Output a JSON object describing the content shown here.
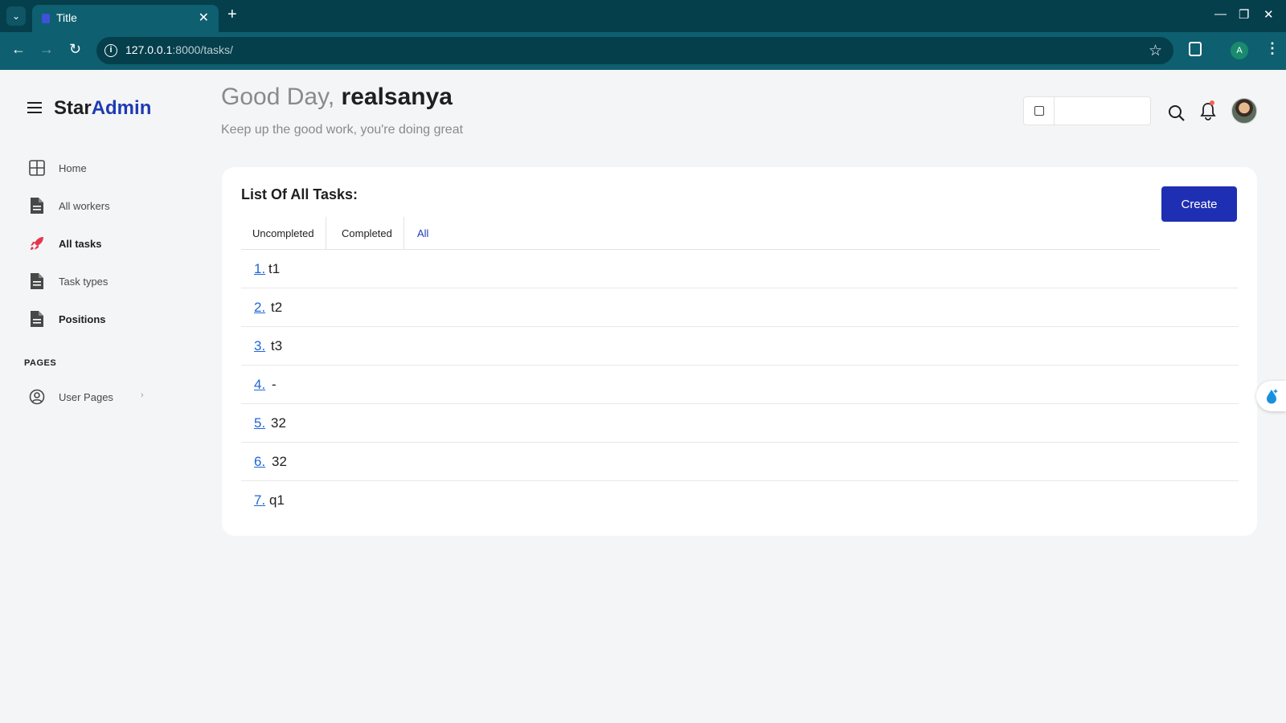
{
  "browser": {
    "tab_title": "Title",
    "url_host": "127.0.0.1",
    "url_path": ":8000/tasks/",
    "profile_initial": "A"
  },
  "sidebar": {
    "brand_main": "Star",
    "brand_accent": "Admin",
    "items": [
      {
        "label": "Home",
        "icon": "grid-icon"
      },
      {
        "label": "All workers",
        "icon": "document-icon"
      },
      {
        "label": "All tasks",
        "icon": "rocket-icon"
      },
      {
        "label": "Task types",
        "icon": "document-icon"
      },
      {
        "label": "Positions",
        "icon": "document-icon"
      }
    ],
    "pages_header": "PAGES",
    "user_pages": {
      "label": "User Pages",
      "icon": "user-circle-icon"
    }
  },
  "header": {
    "greeting": "Good Day,",
    "username": "realsanya",
    "subtitle": "Keep up the good work, you're doing great",
    "date_value": ""
  },
  "card": {
    "title": "List Of All Tasks:",
    "create_label": "Create",
    "tabs": [
      "Uncompleted",
      "Completed",
      "All"
    ],
    "active_tab": "All",
    "tasks": [
      {
        "num": "1.",
        "name": "t1"
      },
      {
        "num": "2.",
        "name": "t2"
      },
      {
        "num": "3.",
        "name": "t3"
      },
      {
        "num": "4.",
        "name": "-"
      },
      {
        "num": "5.",
        "name": "32"
      },
      {
        "num": "6.",
        "name": "32"
      },
      {
        "num": "7.",
        "name": "q1"
      }
    ]
  },
  "colors": {
    "accent": "#1F3BB3",
    "primary_button": "#1F2FB3",
    "link": "#1F65D8",
    "browser_frame": "#053F4C"
  }
}
